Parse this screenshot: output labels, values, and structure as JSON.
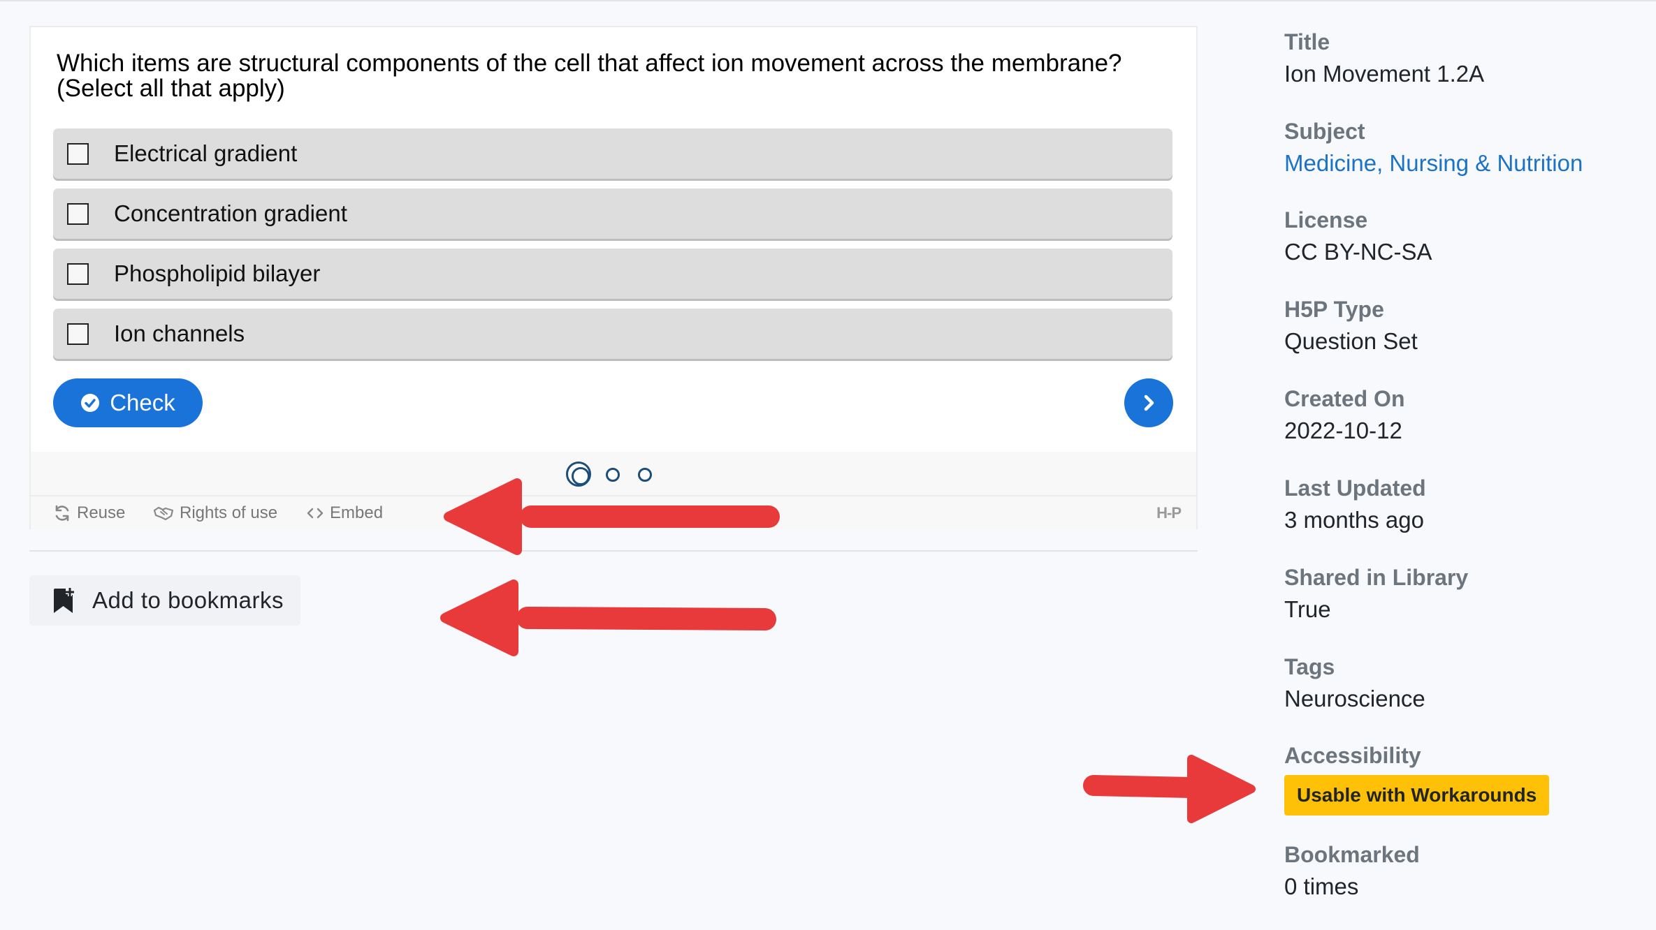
{
  "h5p": {
    "question": "Which items are structural components of the cell that affect ion movement across the membrane? (Select all that apply)",
    "answers": [
      {
        "label": "Electrical gradient",
        "checked": false
      },
      {
        "label": "Concentration gradient",
        "checked": false
      },
      {
        "label": "Phospholipid bilayer",
        "checked": false
      },
      {
        "label": "Ion channels",
        "checked": false
      }
    ],
    "check_label": "Check",
    "progress": {
      "current": 1,
      "total": 3
    },
    "footer": {
      "reuse": "Reuse",
      "rights": "Rights of use",
      "embed": "Embed",
      "logo": "H-P"
    }
  },
  "bookmark": {
    "label": "Add to bookmarks"
  },
  "metadata": {
    "title": {
      "label": "Title",
      "value": "Ion Movement 1.2A"
    },
    "subject": {
      "label": "Subject",
      "value": "Medicine, Nursing & Nutrition"
    },
    "license": {
      "label": "License",
      "value": "CC BY-NC-SA"
    },
    "h5p_type": {
      "label": "H5P Type",
      "value": "Question Set"
    },
    "created_on": {
      "label": "Created On",
      "value": "2022-10-12"
    },
    "last_updated": {
      "label": "Last Updated",
      "value": "3 months ago"
    },
    "shared": {
      "label": "Shared in Library",
      "value": "True"
    },
    "tags": {
      "label": "Tags",
      "value": "Neuroscience"
    },
    "accessibility": {
      "label": "Accessibility",
      "value": "Usable with Workarounds"
    },
    "bookmarked": {
      "label": "Bookmarked",
      "value": "0 times"
    }
  },
  "colors": {
    "primary": "#1a73d9",
    "badge": "#ffc107",
    "annotation_arrow": "#e8393b",
    "link": "#1a73c7"
  }
}
